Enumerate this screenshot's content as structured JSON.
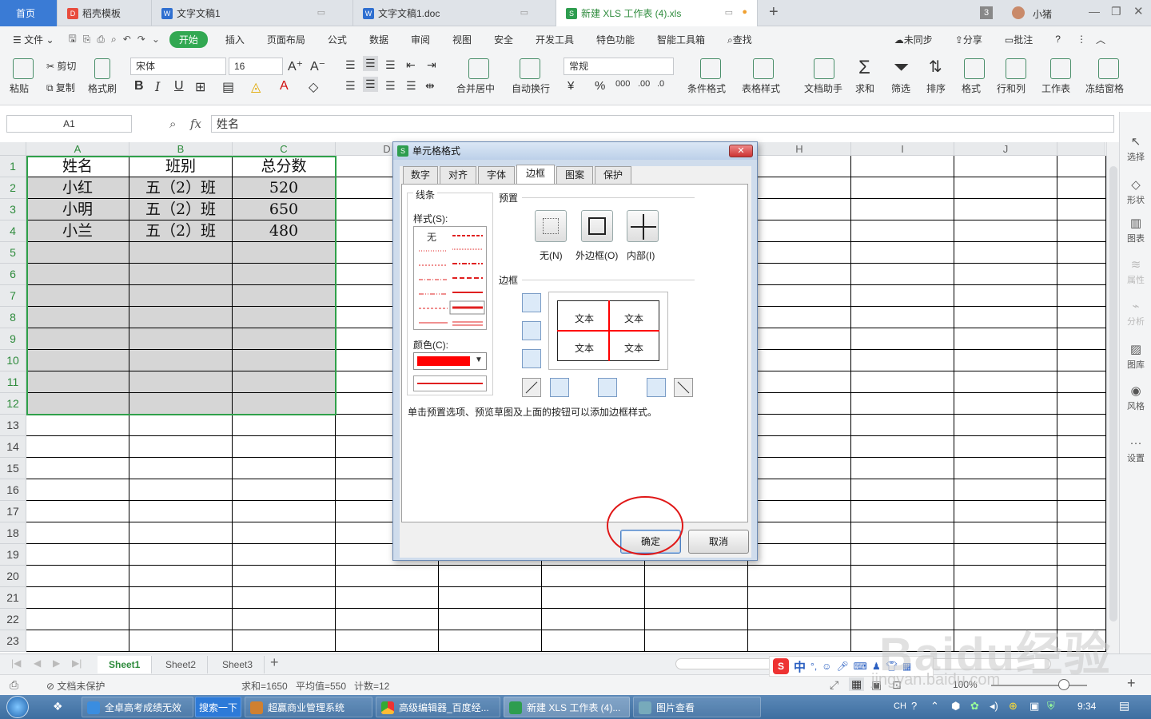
{
  "tabs": [
    {
      "label": "首页"
    },
    {
      "label": "稻壳模板"
    },
    {
      "label": "文字文稿1"
    },
    {
      "label": "文字文稿1.doc"
    },
    {
      "label": "新建 XLS 工作表 (4).xls"
    }
  ],
  "titlebar": {
    "count": "3",
    "user": "小猪"
  },
  "menu": {
    "file": "文件",
    "items": [
      "开始",
      "插入",
      "页面布局",
      "公式",
      "数据",
      "审阅",
      "视图",
      "安全",
      "开发工具",
      "特色功能",
      "智能工具箱"
    ],
    "search": "查找",
    "sync": "未同步",
    "share": "分享",
    "comment": "批注"
  },
  "ribbon": {
    "paste": "粘贴",
    "cut": "剪切",
    "copy": "复制",
    "format_painter": "格式刷",
    "font_name": "宋体",
    "font_size": "16",
    "merge": "合并居中",
    "wrap": "自动换行",
    "number_format": "常规",
    "cond_format": "条件格式",
    "table_style": "表格样式",
    "doc_assist": "文档助手",
    "sum": "求和",
    "filter": "筛选",
    "sort": "排序",
    "format": "格式",
    "rowcol": "行和列",
    "sheet": "工作表",
    "freeze": "冻结窗格"
  },
  "formula": {
    "cellref": "A1",
    "fx": "fx",
    "value": "姓名"
  },
  "columns": [
    "A",
    "B",
    "C",
    "D",
    "E",
    "F",
    "G",
    "H",
    "I",
    "J"
  ],
  "rows": [
    "1",
    "2",
    "3",
    "4",
    "5",
    "6",
    "7",
    "8",
    "9",
    "10",
    "11",
    "12",
    "13",
    "14",
    "15",
    "16",
    "17",
    "18",
    "19",
    "20",
    "21",
    "22",
    "23"
  ],
  "table": [
    [
      "姓名",
      "班别",
      "总分数"
    ],
    [
      "小红",
      "五（2）班",
      "520"
    ],
    [
      "小明",
      "五（2）班",
      "650"
    ],
    [
      "小兰",
      "五（2）班",
      "480"
    ]
  ],
  "right_panel": [
    "选择",
    "形状",
    "图表",
    "属性",
    "分析",
    "图库",
    "风格",
    "设置"
  ],
  "sheets": [
    "Sheet1",
    "Sheet2",
    "Sheet3"
  ],
  "status": {
    "protect": "文档未保护",
    "sum": "求和=1650",
    "avg": "平均值=550",
    "count": "计数=12",
    "zoom": "100%"
  },
  "dialog": {
    "title": "单元格格式",
    "tabs": [
      "数字",
      "对齐",
      "字体",
      "边框",
      "图案",
      "保护"
    ],
    "active_tab": "边框",
    "line_group": "线条",
    "style_label": "样式(S):",
    "style_none": "无",
    "color_label": "颜色(C):",
    "line_color": "#ff0000",
    "preset_group": "预置",
    "preset_none": "无(N)",
    "preset_outline": "外边框(O)",
    "preset_inside": "内部(I)",
    "border_group": "边框",
    "preview_text": [
      "文本",
      "文本",
      "文本",
      "文本"
    ],
    "hint": "单击预置选项、预览草图及上面的按钮可以添加边框样式。",
    "ok": "确定",
    "cancel": "取消"
  },
  "taskbar": {
    "items": [
      "全卓高考成绩无效",
      "搜索一下",
      "超赢商业管理系统",
      "高级编辑器_百度经...",
      "新建 XLS 工作表 (4)...",
      "图片查看"
    ],
    "lang": "CH",
    "clock": "9:34"
  },
  "watermark": {
    "brand": "Baidu经验",
    "url": "jingyan.baidu.com"
  },
  "ime": {
    "lang": "中"
  }
}
